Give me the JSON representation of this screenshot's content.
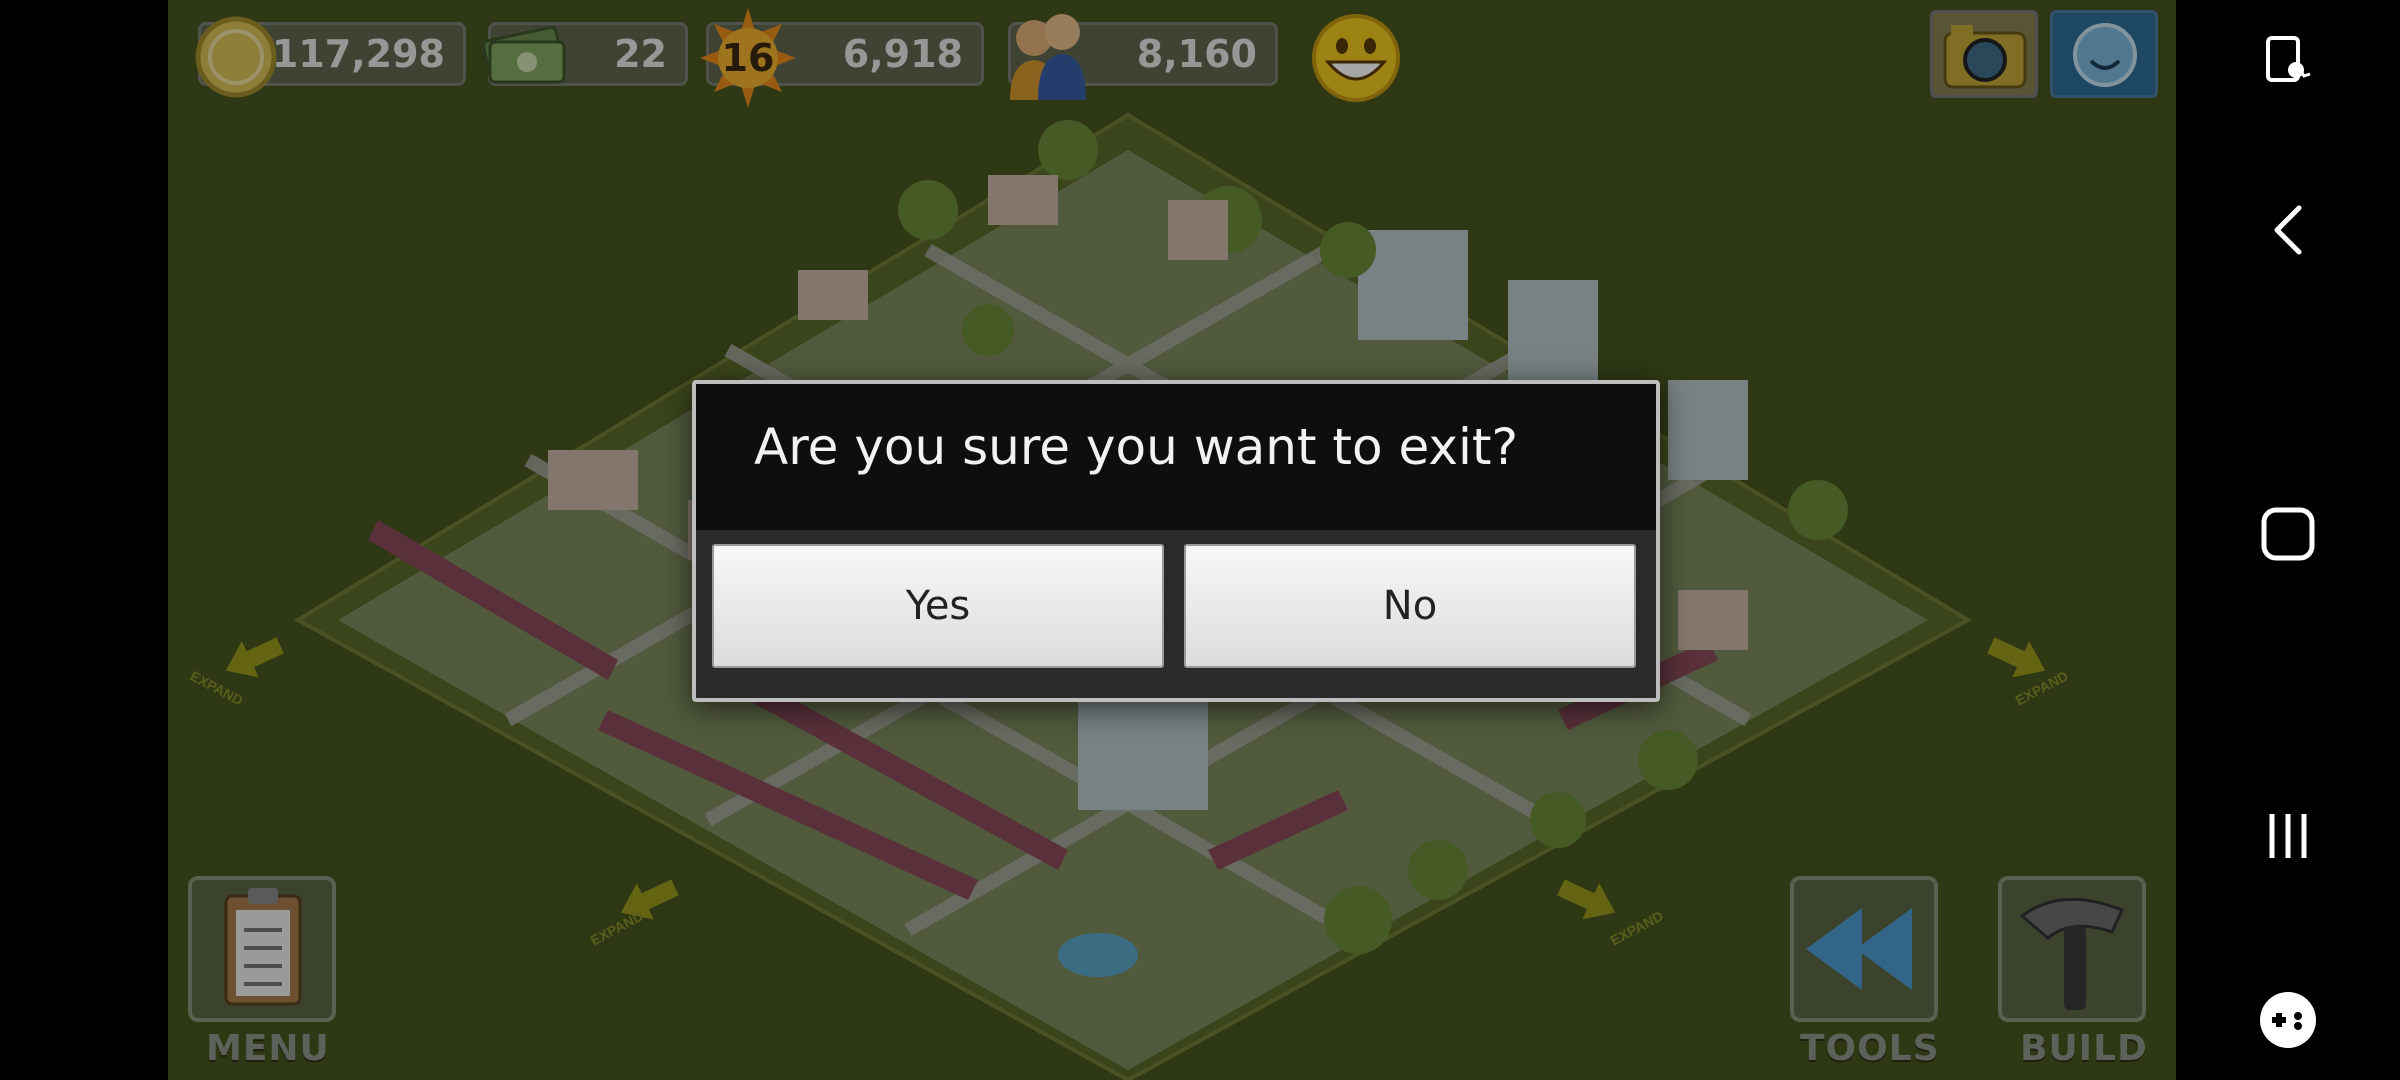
{
  "hud": {
    "coins": "117,298",
    "cash": "22",
    "level": "16",
    "xp": "6,918",
    "population": "8,160"
  },
  "map": {
    "expand_label": "EXPAND"
  },
  "dialog": {
    "title": "Are you sure you want to exit?",
    "yes_label": "Yes",
    "no_label": "No"
  },
  "bottom_bar": {
    "menu_label": "MENU",
    "tools_label": "TOOLS",
    "build_label": "BUILD"
  },
  "colors": {
    "grass": "#48561f",
    "dialog_bg": "#0e0e0e",
    "coin_gold": "#d9c25a"
  },
  "icons": {
    "coins": "coin-icon",
    "cash": "cash-icon",
    "level": "sun-icon",
    "population": "people-icon",
    "happiness": "smiley-icon",
    "camera": "camera-icon",
    "social": "friend-face-icon",
    "menu": "clipboard-icon",
    "tools": "rewind-icon",
    "build": "hammer-icon",
    "nav_rotate": "screen-rotate-icon",
    "nav_back": "back-icon",
    "nav_home": "home-icon",
    "nav_recents": "recents-icon",
    "nav_game": "game-tools-icon"
  }
}
